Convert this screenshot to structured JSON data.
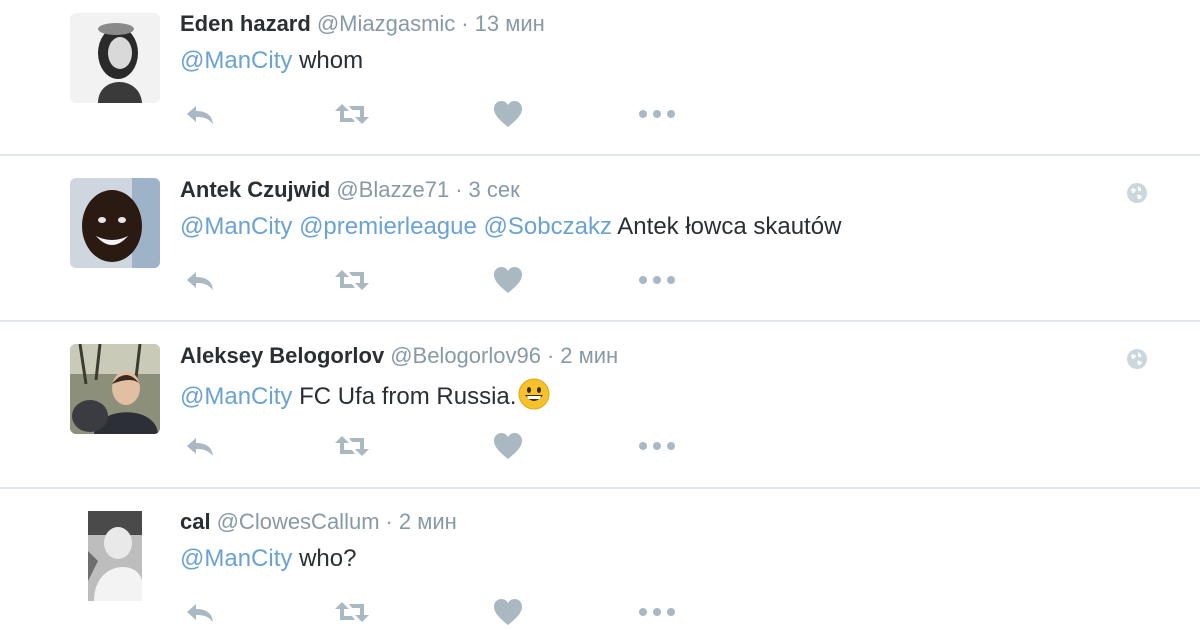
{
  "tweets": [
    {
      "name": "Eden hazard",
      "handle": "@Miazgasmic",
      "separator": "·",
      "time": "13 мин",
      "mentions": [
        "@ManCity"
      ],
      "text": "whom",
      "globe": false,
      "emoji": null
    },
    {
      "name": "Antek Czujwid",
      "handle": "@Blazze71",
      "separator": "·",
      "time": "3 сек",
      "mentions": [
        "@ManCity",
        "@premierleague",
        "@Sobczakz"
      ],
      "text": "Antek łowca skautów",
      "globe": true,
      "emoji": null
    },
    {
      "name": "Aleksey Belogorlov",
      "handle": "@Belogorlov96",
      "separator": "·",
      "time": "2 мин",
      "mentions": [
        "@ManCity"
      ],
      "text": "FC Ufa from Russia.",
      "globe": true,
      "emoji": "grinning-face-emoji"
    },
    {
      "name": "cal",
      "handle": "@ClowesCallum",
      "separator": "·",
      "time": "2 мин",
      "mentions": [
        "@ManCity"
      ],
      "text": "who?",
      "globe": false,
      "emoji": null
    }
  ],
  "action_icons": [
    "reply-icon",
    "retweet-icon",
    "like-icon",
    "more-icon"
  ],
  "colors": {
    "mention": "#6aa2d4",
    "muted": "#8899a6",
    "action_icon": "#aab8c2",
    "divider": "#e1e8ed",
    "name": "#292f33"
  }
}
